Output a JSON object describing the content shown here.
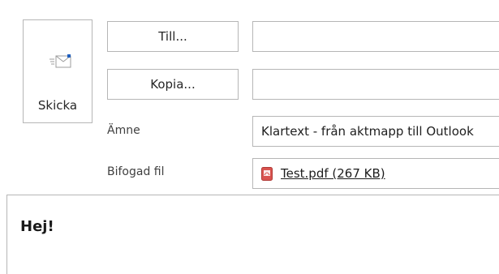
{
  "composer": {
    "send_label": "Skicka",
    "to_label": "Till...",
    "cc_label": "Kopia...",
    "to_value": "",
    "cc_value": "",
    "subject_label": "Ämne",
    "subject_value": "Klartext - från aktmapp till Outlook",
    "attachment_label": "Bifogad fil",
    "attachment_value": "Test.pdf (267 KB)",
    "body_text": "Hej!"
  },
  "icons": {
    "send": "send-envelope-icon",
    "attachment": "pdf-file-icon"
  },
  "colors": {
    "border": "#b6b6b6",
    "pdf_red": "#d9534f",
    "icon_blue": "#1f5fbf"
  }
}
